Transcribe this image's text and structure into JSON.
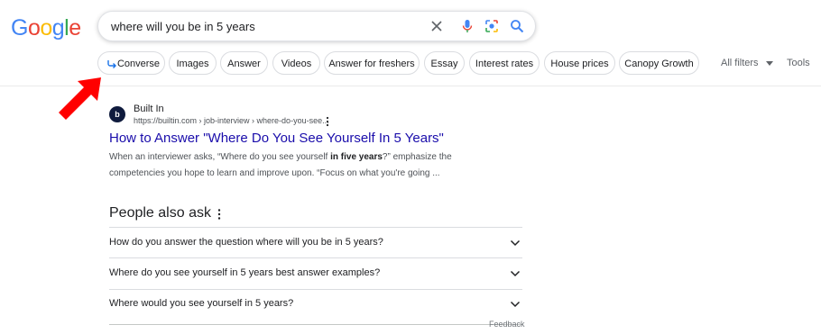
{
  "logo": {
    "letters": [
      "G",
      "o",
      "o",
      "g",
      "l",
      "e"
    ],
    "colors": [
      "#4285f4",
      "#ea4335",
      "#fbbc05",
      "#4285f4",
      "#34a853",
      "#ea4335"
    ]
  },
  "search": {
    "query": "where will you be in 5 years",
    "icons": [
      "clear-icon",
      "mic-icon",
      "lens-icon",
      "search-icon"
    ]
  },
  "chips": [
    {
      "label": "Converse",
      "icon": "converse-arrow-icon"
    },
    {
      "label": "Images"
    },
    {
      "label": "Answer"
    },
    {
      "label": "Videos"
    },
    {
      "label": "Answer for freshers"
    },
    {
      "label": "Essay"
    },
    {
      "label": "Interest rates"
    },
    {
      "label": "House prices"
    },
    {
      "label": "Canopy Growth"
    }
  ],
  "filters": {
    "all_filters": "All filters",
    "tools": "Tools"
  },
  "annotation": {
    "arrow_color": "#ff0000"
  },
  "result": {
    "favicon": "b",
    "site_name": "Built In",
    "url": "https://builtin.com › job-interview › where-do-you-see...",
    "title": "How to Answer \"Where Do You See Yourself In 5 Years\"",
    "snippet_pre": "When an interviewer asks, “Where do you see yourself ",
    "snippet_bold": "in five years",
    "snippet_post": "?” emphasize the competencies you hope to learn and improve upon. “Focus on what you're going ..."
  },
  "paa": {
    "title": "People also ask",
    "questions": [
      "How do you answer the question where will you be in 5 years?",
      "Where do you see yourself in 5 years best answer examples?",
      "Where would you see yourself in 5 years?"
    ],
    "feedback": "Feedback"
  }
}
